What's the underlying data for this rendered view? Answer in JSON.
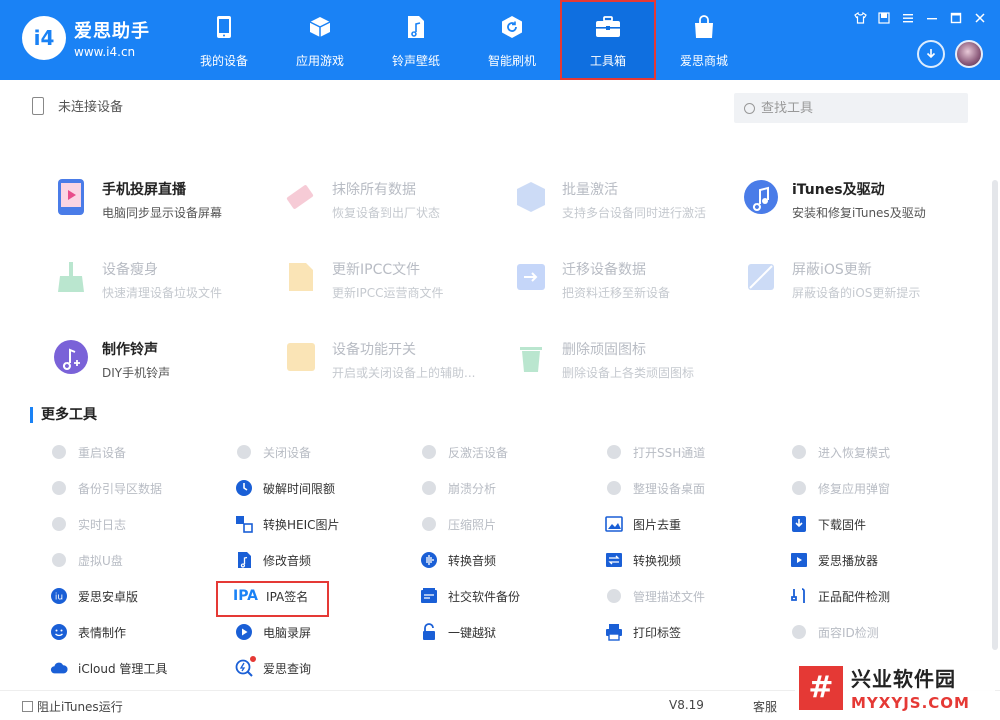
{
  "app": {
    "name": "爱思助手",
    "url": "www.i4.cn",
    "logo_mark": "i4"
  },
  "nav": [
    {
      "label": "我的设备",
      "icon": "phone-icon"
    },
    {
      "label": "应用游戏",
      "icon": "cube-icon"
    },
    {
      "label": "铃声壁纸",
      "icon": "music-file-icon"
    },
    {
      "label": "智能刷机",
      "icon": "refresh-box-icon"
    },
    {
      "label": "工具箱",
      "icon": "toolbox-icon",
      "active": true
    },
    {
      "label": "爱思商城",
      "icon": "shopping-bag-icon"
    }
  ],
  "device_status": "未连接设备",
  "search": {
    "placeholder": "查找工具"
  },
  "tools": [
    {
      "title": "手机投屏直播",
      "desc": "电脑同步显示设备屏幕",
      "enabled": true,
      "icon": "screen-mirror-icon"
    },
    {
      "title": "抹除所有数据",
      "desc": "恢复设备到出厂状态",
      "enabled": false,
      "icon": "eraser-icon"
    },
    {
      "title": "批量激活",
      "desc": "支持多台设备同时进行激活",
      "enabled": false,
      "icon": "batch-activate-icon"
    },
    {
      "title": "iTunes及驱动",
      "desc": "安装和修复iTunes及驱动",
      "enabled": true,
      "icon": "itunes-icon"
    },
    {
      "title": "设备瘦身",
      "desc": "快速清理设备垃圾文件",
      "enabled": false,
      "icon": "broom-icon"
    },
    {
      "title": "更新IPCC文件",
      "desc": "更新IPCC运营商文件",
      "enabled": false,
      "icon": "ipcc-file-icon"
    },
    {
      "title": "迁移设备数据",
      "desc": "把资料迁移至新设备",
      "enabled": false,
      "icon": "migrate-icon"
    },
    {
      "title": "屏蔽iOS更新",
      "desc": "屏蔽设备的iOS更新提示",
      "enabled": false,
      "icon": "block-update-icon"
    },
    {
      "title": "制作铃声",
      "desc": "DIY手机铃声",
      "enabled": true,
      "icon": "ringtone-icon"
    },
    {
      "title": "设备功能开关",
      "desc": "开启或关闭设备上的辅助...",
      "enabled": false,
      "icon": "toggle-sliders-icon"
    },
    {
      "title": "删除顽固图标",
      "desc": "删除设备上各类顽固图标",
      "enabled": false,
      "icon": "trash-icon"
    }
  ],
  "more_tools_title": "更多工具",
  "more_tools": [
    {
      "label": "重启设备",
      "enabled": false,
      "icon": "restart-icon"
    },
    {
      "label": "关闭设备",
      "enabled": false,
      "icon": "power-icon"
    },
    {
      "label": "反激活设备",
      "enabled": false,
      "icon": "deactivate-icon"
    },
    {
      "label": "打开SSH通道",
      "enabled": false,
      "icon": "ssh-icon"
    },
    {
      "label": "进入恢复模式",
      "enabled": false,
      "icon": "recovery-mode-icon"
    },
    {
      "label": "备份引导区数据",
      "enabled": false,
      "icon": "backup-boot-icon"
    },
    {
      "label": "破解时间限额",
      "enabled": true,
      "icon": "clock-icon"
    },
    {
      "label": "崩溃分析",
      "enabled": false,
      "icon": "crash-analysis-icon"
    },
    {
      "label": "整理设备桌面",
      "enabled": false,
      "icon": "grid-icon"
    },
    {
      "label": "修复应用弹窗",
      "enabled": false,
      "icon": "repair-popup-icon"
    },
    {
      "label": "实时日志",
      "enabled": false,
      "icon": "log-icon"
    },
    {
      "label": "转换HEIC图片",
      "enabled": true,
      "icon": "heic-convert-icon"
    },
    {
      "label": "压缩照片",
      "enabled": false,
      "icon": "compress-photo-icon"
    },
    {
      "label": "图片去重",
      "enabled": true,
      "icon": "image-dedupe-icon"
    },
    {
      "label": "下载固件",
      "enabled": true,
      "icon": "firmware-download-icon"
    },
    {
      "label": "虚拟U盘",
      "enabled": false,
      "icon": "usb-drive-icon"
    },
    {
      "label": "修改音频",
      "enabled": true,
      "icon": "audio-edit-icon"
    },
    {
      "label": "转换音频",
      "enabled": true,
      "icon": "audio-convert-icon"
    },
    {
      "label": "转换视频",
      "enabled": true,
      "icon": "video-convert-icon"
    },
    {
      "label": "爱思播放器",
      "enabled": true,
      "icon": "player-icon"
    },
    {
      "label": "爱思安卓版",
      "enabled": true,
      "icon": "android-app-icon"
    },
    {
      "label": "IPA签名",
      "enabled": true,
      "icon": "ipa-sign-icon",
      "icon_text": "IPA"
    },
    {
      "label": "社交软件备份",
      "enabled": true,
      "icon": "social-backup-icon"
    },
    {
      "label": "管理描述文件",
      "enabled": false,
      "icon": "profile-manage-icon"
    },
    {
      "label": "正品配件检测",
      "enabled": true,
      "icon": "accessory-check-icon"
    },
    {
      "label": "表情制作",
      "enabled": true,
      "icon": "emoji-icon"
    },
    {
      "label": "电脑录屏",
      "enabled": true,
      "icon": "screen-record-icon"
    },
    {
      "label": "一键越狱",
      "enabled": true,
      "icon": "jailbreak-icon"
    },
    {
      "label": "打印标签",
      "enabled": true,
      "icon": "printer-icon"
    },
    {
      "label": "面容ID检测",
      "enabled": false,
      "icon": "face-id-icon"
    },
    {
      "label": "iCloud 管理工具",
      "enabled": true,
      "icon": "icloud-icon"
    },
    {
      "label": "爱思查询",
      "enabled": true,
      "icon": "query-icon"
    }
  ],
  "footer": {
    "itunes_checkbox": "阻止iTunes运行",
    "version": "V8.19",
    "service": "客服"
  },
  "watermark": {
    "cn": "兴业软件园",
    "en": "MYXYJS.COM",
    "mark": "#"
  },
  "colors": {
    "header_bg": "#1a82f5",
    "active_tab_bg": "#0f6fe0",
    "highlight_border": "#e53935",
    "accent": "#1a82f5"
  }
}
